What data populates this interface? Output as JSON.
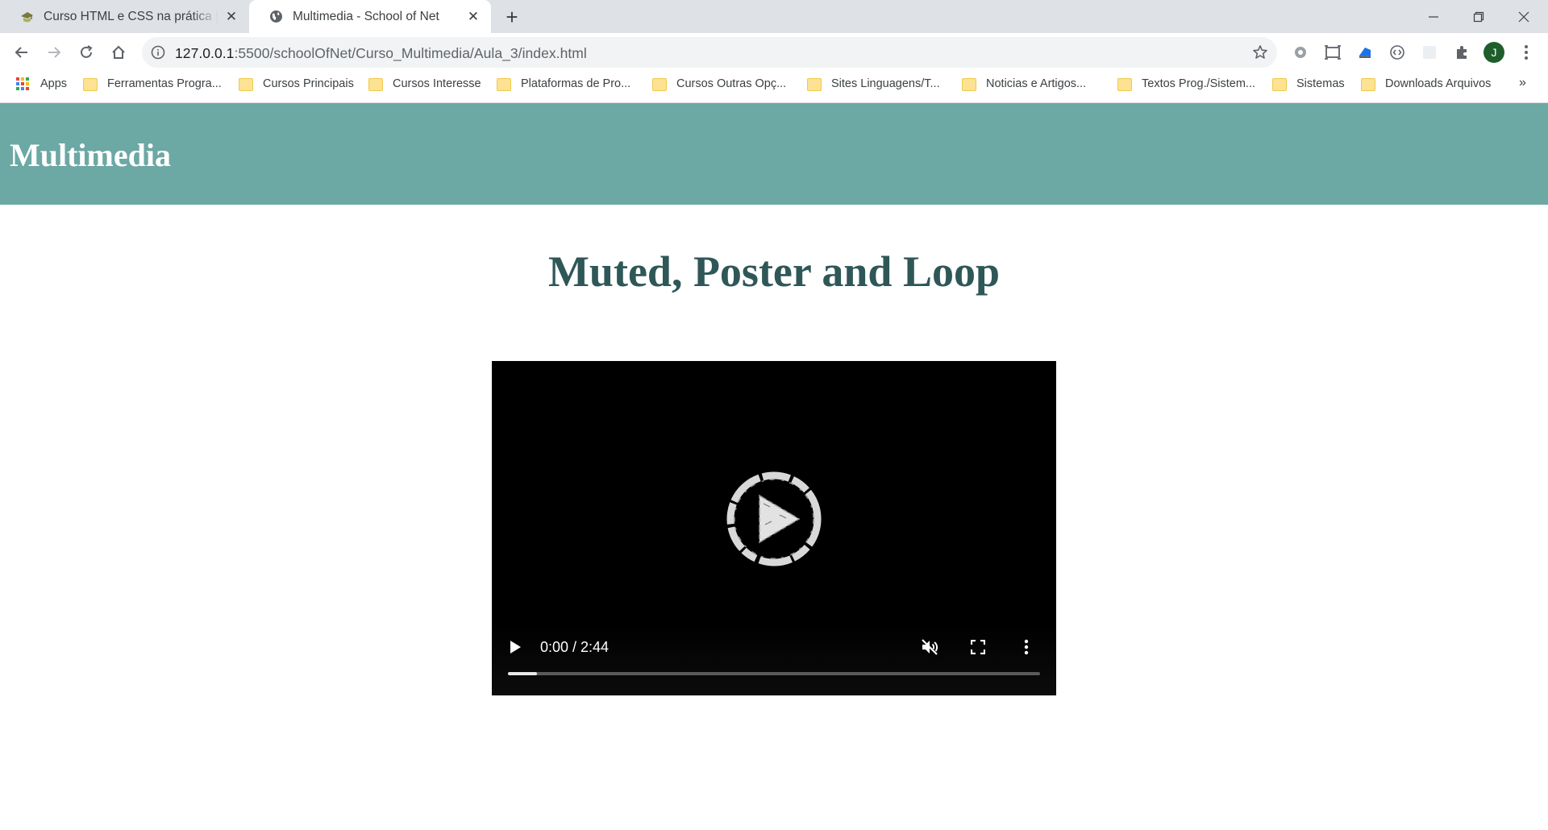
{
  "browser": {
    "tabs": [
      {
        "title": "Curso HTML e CSS na prática | School of Net",
        "active": false,
        "favicon": "school-of-net-icon"
      },
      {
        "title": "Multimedia - School of Net",
        "active": true,
        "favicon": "globe-icon"
      }
    ],
    "url_host": "127.0.0.1",
    "url_rest": ":5500/schoolOfNet/Curso_Multimedia/Aula_3/index.html",
    "avatar_letter": "J",
    "bookmarks": [
      {
        "label": "Apps",
        "icon": "apps-grid-icon"
      },
      {
        "label": "Ferramentas Progra...",
        "icon": "folder-icon"
      },
      {
        "label": "Cursos Principais",
        "icon": "folder-icon"
      },
      {
        "label": "Cursos Interesse",
        "icon": "folder-icon"
      },
      {
        "label": "Plataformas de Pro...",
        "icon": "folder-icon"
      },
      {
        "label": "Cursos Outras Opç...",
        "icon": "folder-icon"
      },
      {
        "label": "Sites Linguagens/T...",
        "icon": "folder-icon"
      },
      {
        "label": "Noticias e Artigos...",
        "icon": "folder-icon"
      },
      {
        "label": "Textos Prog./Sistem...",
        "icon": "folder-icon"
      },
      {
        "label": "Sistemas",
        "icon": "folder-icon"
      },
      {
        "label": "Downloads Arquivos",
        "icon": "folder-icon"
      }
    ],
    "bookmarks_overflow": "»"
  },
  "page": {
    "header_title": "Multimedia",
    "header_bg": "#6ca8a4",
    "section_title": "Muted, Poster and Loop",
    "section_title_color": "#2f5757",
    "video": {
      "time": "0:00 / 2:44",
      "muted": true,
      "buffered_fraction": 0.055,
      "icons": [
        "play-icon",
        "muted-volume-icon",
        "fullscreen-icon",
        "more-options-icon"
      ]
    }
  }
}
